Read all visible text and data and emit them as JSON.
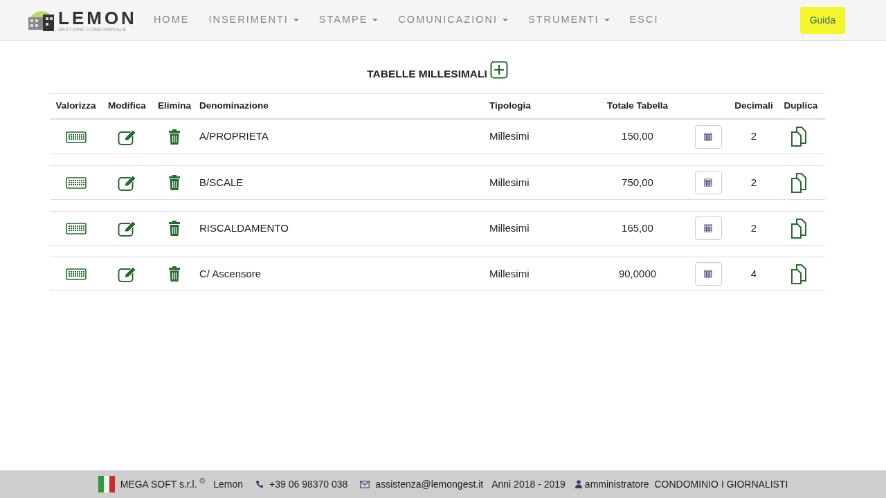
{
  "navbar": {
    "logo": {
      "name": "LEMON",
      "tagline": "GESTIONE CONDOMINIALE"
    },
    "menu": [
      {
        "label": "HOME",
        "dropdown": false
      },
      {
        "label": "INSERIMENTI",
        "dropdown": true
      },
      {
        "label": "STAMPE",
        "dropdown": true
      },
      {
        "label": "COMUNICAZIONI",
        "dropdown": true
      },
      {
        "label": "STRUMENTI",
        "dropdown": true
      },
      {
        "label": "ESCI",
        "dropdown": false
      }
    ],
    "help_button": "Guida"
  },
  "page_title": "TABELLE MILLESIMALI",
  "table": {
    "columns": [
      "Valorizza",
      "Modifica",
      "Elimina",
      "Denominazione",
      "Tipologia",
      "Totale Tabella",
      "Decimali",
      "Duplica"
    ],
    "rows": [
      {
        "denominazione": "A/PROPRIETA",
        "tipologia": "Millesimi",
        "totale": "150,00",
        "decimali": "2"
      },
      {
        "denominazione": "B/SCALE",
        "tipologia": "Millesimi",
        "totale": "750,00",
        "decimali": "2"
      },
      {
        "denominazione": "RISCALDAMENTO",
        "tipologia": "Millesimi",
        "totale": "165,00",
        "decimali": "2"
      },
      {
        "denominazione": "C/ Ascensore",
        "tipologia": "Millesimi",
        "totale": "90,0000",
        "decimali": "4"
      }
    ]
  },
  "footer": {
    "company": "MEGA SOFT s.r.l.",
    "copyright": "©",
    "product": "Lemon",
    "phone": "+39 06 98370 038",
    "email": "assistenza@lemongest.it",
    "years": "Anni 2018 - 2019",
    "user": "amministratore",
    "condominium": "CONDOMINIO I GIORNALISTI"
  }
}
